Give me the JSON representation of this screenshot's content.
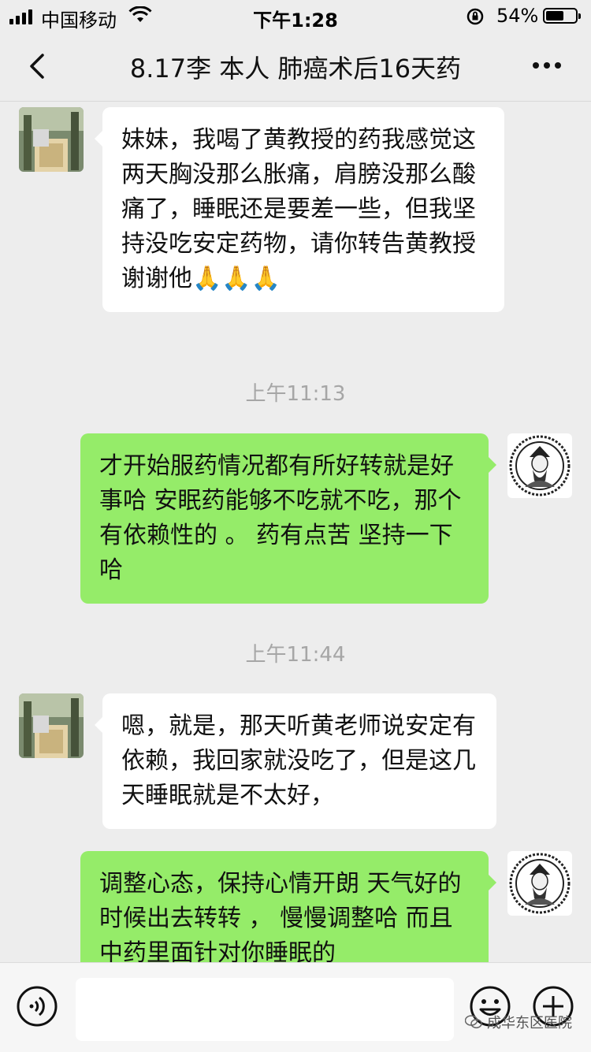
{
  "status_bar": {
    "carrier": "中国移动",
    "time": "下午1:28",
    "battery_percent": "54%"
  },
  "nav": {
    "title": "8.17李       本人 肺癌术后16天药"
  },
  "messages": [
    {
      "direction": "incoming",
      "text": "妹妹，我喝了黄教授的药我感觉这两天胸没那么胀痛，肩膀没那么酸痛了，睡眠还是要差一些，但我坚持没吃安定药物，请你转告黄教授谢谢他🙏🙏🙏"
    },
    {
      "type": "timestamp",
      "text": "上午11:13"
    },
    {
      "direction": "outgoing",
      "text": "才开始服药情况都有所好转就是好事哈 安眠药能够不吃就不吃，那个有依赖性的 。 药有点苦 坚持一下哈"
    },
    {
      "type": "timestamp",
      "text": "上午11:44"
    },
    {
      "direction": "incoming",
      "text": "嗯，就是，那天听黄老师说安定有依赖，我回家就没吃了，但是这几天睡眠就是不太好，"
    },
    {
      "direction": "outgoing",
      "text": "调整心态，保持心情开朗 天气好的时候出去转转 ， 慢慢调整哈 而且中药里面针对你睡眠的"
    }
  ],
  "input_bar": {
    "placeholder": "",
    "watermark": "成华东区医院"
  },
  "icons": {
    "back": "chevron-left-icon",
    "more": "more-dots-icon",
    "voice": "voice-icon",
    "emoji": "emoji-icon",
    "add": "plus-icon"
  },
  "colors": {
    "background": "#ededed",
    "incoming_bubble": "#ffffff",
    "outgoing_bubble": "#95ec69",
    "timestamp": "#a6a6a6"
  }
}
